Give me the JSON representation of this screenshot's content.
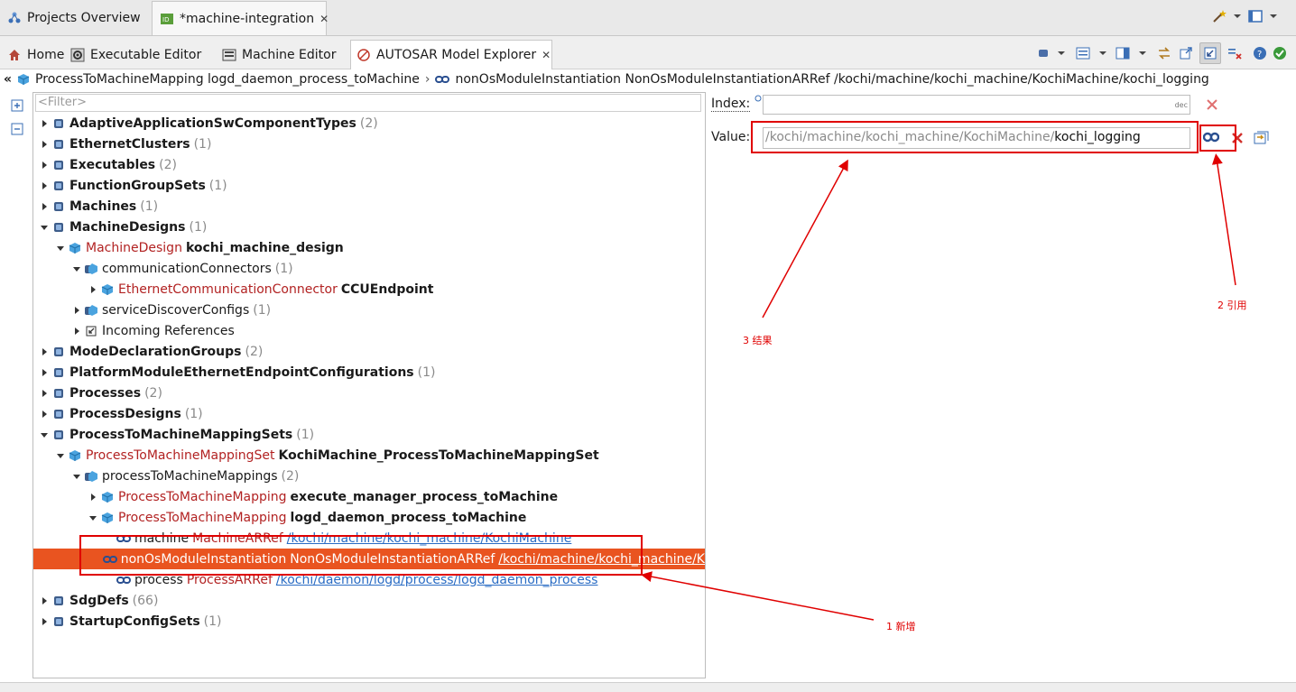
{
  "top_tabs": [
    {
      "label": "Projects Overview",
      "icon": "projects-icon"
    },
    {
      "label": "*machine-integration",
      "icon": "editor-file-icon",
      "close": "✕"
    }
  ],
  "editor_tabs": [
    {
      "label": "Home",
      "icon": "home-icon"
    },
    {
      "label": "Executable Editor",
      "icon": "executable-editor-icon"
    },
    {
      "label": "Machine Editor",
      "icon": "machine-editor-icon"
    },
    {
      "label": "AUTOSAR Model Explorer",
      "icon": "explorer-icon",
      "close": "✕"
    }
  ],
  "breadcrumb": {
    "collapse": "«",
    "item1": "ProcessToMachineMapping logd_daemon_process_toMachine",
    "separator": "›",
    "item2": "nonOsModuleInstantiation NonOsModuleInstantiationARRef /kochi/machine/kochi_machine/KochiMachine/kochi_logging"
  },
  "filter_placeholder": "<Filter>",
  "tree": [
    {
      "depth": 0,
      "expanded": false,
      "name": "AdaptiveApplicationSwComponentTypes",
      "count": "(2)"
    },
    {
      "depth": 0,
      "expanded": false,
      "name": "EthernetClusters",
      "count": "(1)"
    },
    {
      "depth": 0,
      "expanded": false,
      "name": "Executables",
      "count": "(2)"
    },
    {
      "depth": 0,
      "expanded": false,
      "name": "FunctionGroupSets",
      "count": "(1)"
    },
    {
      "depth": 0,
      "expanded": false,
      "name": "Machines",
      "count": "(1)"
    },
    {
      "depth": 0,
      "expanded": true,
      "name": "MachineDesigns",
      "count": "(1)"
    },
    {
      "depth": 1,
      "expanded": true,
      "type": "MachineDesign",
      "name": "kochi_machine_design"
    },
    {
      "depth": 2,
      "expanded": true,
      "name": "communicationConnectors",
      "count": "(1)",
      "plain": true
    },
    {
      "depth": 3,
      "expanded": false,
      "type": "EthernetCommunicationConnector",
      "name": "CCUEndpoint"
    },
    {
      "depth": 2,
      "expanded": false,
      "name": "serviceDiscoverConfigs",
      "count": "(1)",
      "plain": true
    },
    {
      "depth": 2,
      "expanded": false,
      "name": "Incoming References",
      "plain": true,
      "icon": "incoming-ref"
    },
    {
      "depth": 0,
      "expanded": false,
      "name": "ModeDeclarationGroups",
      "count": "(2)"
    },
    {
      "depth": 0,
      "expanded": false,
      "name": "PlatformModuleEthernetEndpointConfigurations",
      "count": "(1)"
    },
    {
      "depth": 0,
      "expanded": false,
      "name": "Processes",
      "count": "(2)"
    },
    {
      "depth": 0,
      "expanded": false,
      "name": "ProcessDesigns",
      "count": "(1)"
    },
    {
      "depth": 0,
      "expanded": true,
      "name": "ProcessToMachineMappingSets",
      "count": "(1)"
    },
    {
      "depth": 1,
      "expanded": true,
      "type": "ProcessToMachineMappingSet",
      "name": "KochiMachine_ProcessToMachineMappingSet"
    },
    {
      "depth": 2,
      "expanded": true,
      "name": "processToMachineMappings",
      "count": "(2)",
      "plain": true
    },
    {
      "depth": 3,
      "expanded": false,
      "type": "ProcessToMachineMapping",
      "name": "execute_manager_process_toMachine"
    },
    {
      "depth": 3,
      "expanded": true,
      "type": "ProcessToMachineMapping",
      "name": "logd_daemon_process_toMachine"
    },
    {
      "depth": 4,
      "leaf": true,
      "icon": "ref",
      "name": "machine",
      "type": "MachineARRef",
      "link": "/kochi/machine/kochi_machine/KochiMachine"
    },
    {
      "depth": 4,
      "leaf": true,
      "icon": "ref",
      "name": "nonOsModuleInstantiation",
      "type": "NonOsModuleInstantiationARRef",
      "link": "/kochi/machine/kochi_machine/K",
      "selected": true
    },
    {
      "depth": 4,
      "leaf": true,
      "icon": "ref",
      "name": "process",
      "type": "ProcessARRef",
      "link": "/kochi/daemon/logd/process/logd_daemon_process"
    },
    {
      "depth": 0,
      "expanded": false,
      "name": "SdgDefs",
      "count": "(66)"
    },
    {
      "depth": 0,
      "expanded": false,
      "name": "StartupConfigSets",
      "count": "(1)"
    }
  ],
  "properties": {
    "index_label": "Index:",
    "index_hint": "dec",
    "value_label": "Value:",
    "value_prefix": "/kochi/machine/kochi_machine/KochiMachine/",
    "value_suffix": "kochi_logging"
  },
  "annotations": {
    "note1": "1 新增",
    "note2": "2 引用",
    "note3": "3 结果"
  },
  "colors": {
    "selection": "#e95420",
    "annotation": "#e00000",
    "type_text": "#b22222",
    "link": "#2a6cc4"
  }
}
